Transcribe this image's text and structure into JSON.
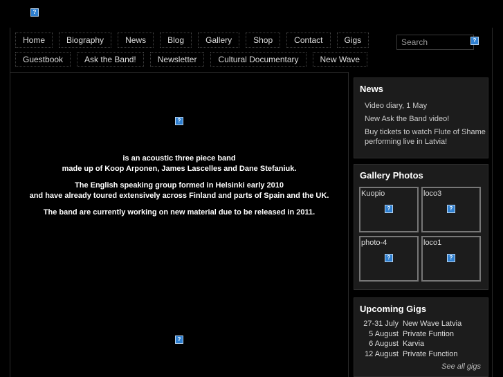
{
  "nav": {
    "row1": [
      "Home",
      "Biography",
      "News",
      "Blog",
      "Gallery",
      "Shop",
      "Contact",
      "Gigs"
    ],
    "row2": [
      "Guestbook",
      "Ask the Band!",
      "Newsletter",
      "Cultural Documentary",
      "New Wave"
    ]
  },
  "search": {
    "placeholder": "Search"
  },
  "broken_image_glyph": "?",
  "intro": {
    "p1_line1": "is an acoustic three piece band",
    "p1_line2": "made up of Koop Arponen, James Lascelles and Dane Stefaniuk.",
    "p2_line1": "The English speaking group formed in Helsinki early 2010",
    "p2_line2": "and have already toured extensively across Finland and parts of Spain and the UK.",
    "p3": "The band are currently working on new material due to be released in 2011."
  },
  "news": {
    "title": "News",
    "items": [
      "Video diary, 1 May",
      "New Ask the Band video!",
      "Buy tickets to watch Flute of Shame performing live in Latvia!"
    ]
  },
  "gallery": {
    "title": "Gallery Photos",
    "photos": [
      "Kuopio",
      "loco3",
      "photo-4",
      "loco1"
    ]
  },
  "gigs": {
    "title": "Upcoming Gigs",
    "rows": [
      {
        "date": "27-31 July",
        "event": "New Wave Latvia"
      },
      {
        "date": "5 August",
        "event": "Private Funtion"
      },
      {
        "date": "6 August",
        "event": "Karvia"
      },
      {
        "date": "12 August",
        "event": "Private Function"
      }
    ],
    "see_all": "See all gigs"
  }
}
